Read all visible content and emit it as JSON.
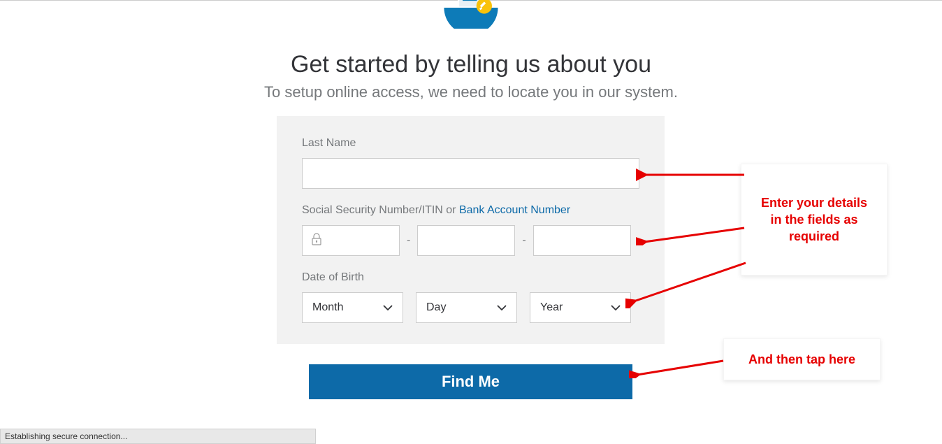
{
  "header": {
    "title": "Get started by telling us about you",
    "subtitle": "To setup online access, we need to locate you in our system."
  },
  "form": {
    "lastName": {
      "label": "Last Name",
      "value": ""
    },
    "ssn": {
      "labelPrefix": "Social Security Number/ITIN  or ",
      "link": "Bank Account Number",
      "dash": "-"
    },
    "dob": {
      "label": "Date of Birth",
      "month": "Month",
      "day": "Day",
      "year": "Year"
    },
    "submit": "Find Me"
  },
  "annotations": {
    "box1": "Enter your details in the fields as required",
    "box2": "And then tap here"
  },
  "status": "Establishing secure connection...",
  "colors": {
    "accent": "#0d6aa8",
    "annotation": "#e60000"
  }
}
